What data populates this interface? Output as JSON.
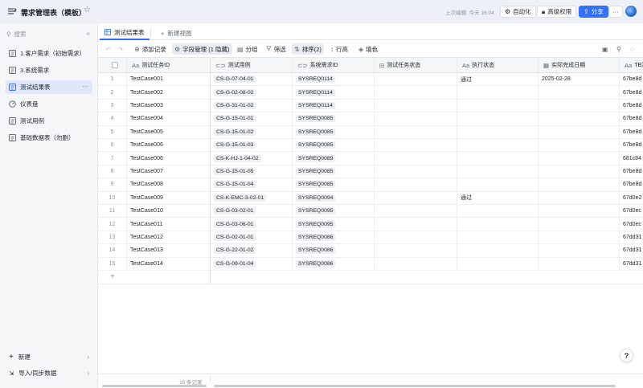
{
  "header": {
    "title": "需求管理表（模板）",
    "last_edited": "上次编辑: 今天 16:04",
    "automation_label": "自动化",
    "permissions_label": "高级权限",
    "share_label": "分享",
    "more_label": "···"
  },
  "sidebar": {
    "search_placeholder": "搜索",
    "items": [
      {
        "label": "1.客户需求（初始需求）",
        "icon": "table-icon"
      },
      {
        "label": "3.系统需求",
        "icon": "table-icon"
      },
      {
        "label": "测试结果表",
        "icon": "table-icon",
        "active": true
      },
      {
        "label": "仪表盘",
        "icon": "dashboard-icon"
      },
      {
        "label": "测试用例",
        "icon": "table-icon"
      },
      {
        "label": "基础数据表（勿删）",
        "icon": "table-icon"
      }
    ],
    "new_label": "新建",
    "import_label": "导入/同步数据"
  },
  "tabs": {
    "active_label": "测试结果表",
    "new_view_label": "新建视图"
  },
  "toolbar": {
    "add_record": "添加记录",
    "field_manage": "字段管理 (1 隐藏)",
    "group": "分组",
    "filter": "筛选",
    "sort": "排序(2)",
    "row_height": "行高",
    "fill_color": "填色"
  },
  "grid": {
    "columns": [
      "测试任务ID",
      "测试用例",
      "系统需求ID",
      "测试任务状态",
      "执行状态",
      "实际完成日期",
      "TB测"
    ],
    "rows": [
      {
        "n": "1",
        "task": "TestCase001",
        "case": "CS-G-07-04-01",
        "req": "SYSREQ0114",
        "status": "",
        "exec": "通过",
        "date": "2025-02-28",
        "tb": "67be8d"
      },
      {
        "n": "2",
        "task": "TestCase002",
        "case": "CS-G-02-08-02",
        "req": "SYSREQ0114",
        "status": "",
        "exec": "",
        "date": "",
        "tb": "67be8d"
      },
      {
        "n": "3",
        "task": "TestCase003",
        "case": "CS-G-31-01-02",
        "req": "SYSREQ0114",
        "status": "",
        "exec": "",
        "date": "",
        "tb": "67be8d"
      },
      {
        "n": "4",
        "task": "TestCase004",
        "case": "CS-G-15-01-01",
        "req": "SYSREQ0085",
        "status": "",
        "exec": "",
        "date": "",
        "tb": "67be8d"
      },
      {
        "n": "5",
        "task": "TestCase005",
        "case": "CS-G-15-01-02",
        "req": "SYSREQ0085",
        "status": "",
        "exec": "",
        "date": "",
        "tb": "67be8d"
      },
      {
        "n": "6",
        "task": "TestCase006",
        "case": "CS-G-15-01-03",
        "req": "SYSREQ0085",
        "status": "",
        "exec": "",
        "date": "",
        "tb": "67be8d"
      },
      {
        "n": "7",
        "task": "TestCase006",
        "case": "CS-K-HJ-1-04-02",
        "req": "SYSREQ0089",
        "status": "",
        "exec": "",
        "date": "",
        "tb": "681c84"
      },
      {
        "n": "8",
        "task": "TestCase007",
        "case": "CS-G-15-01-05",
        "req": "SYSREQ0085",
        "status": "",
        "exec": "",
        "date": "",
        "tb": "67be8d"
      },
      {
        "n": "9",
        "task": "TestCase008",
        "case": "CS-G-15-01-04",
        "req": "SYSREQ0085",
        "status": "",
        "exec": "",
        "date": "",
        "tb": "67be8d"
      },
      {
        "n": "10",
        "task": "TestCase009",
        "case": "CS-K-EMC-3-02-01",
        "req": "SYSREQ0094",
        "status": "",
        "exec": "通过",
        "date": "",
        "tb": "67d0e2"
      },
      {
        "n": "11",
        "task": "TestCase010",
        "case": "CS-G-03-02-01",
        "req": "SYSREQ0095",
        "status": "",
        "exec": "",
        "date": "",
        "tb": "67d0ec"
      },
      {
        "n": "12",
        "task": "TestCase011",
        "case": "CS-G-03-06-01",
        "req": "SYSREQ0095",
        "status": "",
        "exec": "",
        "date": "",
        "tb": "67d0ec"
      },
      {
        "n": "13",
        "task": "TestCase012",
        "case": "CS-G-02-01-01",
        "req": "SYSREQ0086",
        "status": "",
        "exec": "",
        "date": "",
        "tb": "67dd31"
      },
      {
        "n": "14",
        "task": "TestCase013",
        "case": "CS-G-22-01-02",
        "req": "SYSREQ0086",
        "status": "",
        "exec": "",
        "date": "",
        "tb": "67dd31"
      },
      {
        "n": "15",
        "task": "TestCase014",
        "case": "CS-G-09-01-04",
        "req": "SYSREQ0086",
        "status": "",
        "exec": "",
        "date": "",
        "tb": "67dd31"
      }
    ]
  },
  "footer": {
    "record_count": "15 条记录"
  },
  "help_label": "?",
  "colors": {
    "accent": "#3370ff",
    "sidebar_active": "#e0e7fb",
    "header_bg": "#eef0f7"
  }
}
